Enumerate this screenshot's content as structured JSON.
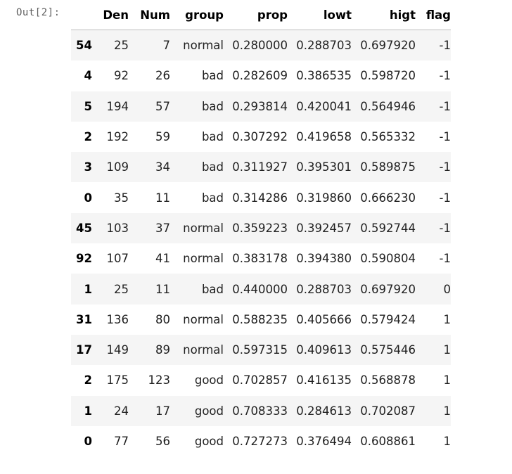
{
  "prompt": "Out[2]:",
  "columns": {
    "index": "",
    "den": "Den",
    "num": "Num",
    "group": "group",
    "prop": "prop",
    "lowt": "lowt",
    "higt": "higt",
    "flag": "flag"
  },
  "rows": [
    {
      "idx": "54",
      "den": "25",
      "num": "7",
      "group": "normal",
      "prop": "0.280000",
      "lowt": "0.288703",
      "higt": "0.697920",
      "flag": "-1"
    },
    {
      "idx": "4",
      "den": "92",
      "num": "26",
      "group": "bad",
      "prop": "0.282609",
      "lowt": "0.386535",
      "higt": "0.598720",
      "flag": "-1"
    },
    {
      "idx": "5",
      "den": "194",
      "num": "57",
      "group": "bad",
      "prop": "0.293814",
      "lowt": "0.420041",
      "higt": "0.564946",
      "flag": "-1"
    },
    {
      "idx": "2",
      "den": "192",
      "num": "59",
      "group": "bad",
      "prop": "0.307292",
      "lowt": "0.419658",
      "higt": "0.565332",
      "flag": "-1"
    },
    {
      "idx": "3",
      "den": "109",
      "num": "34",
      "group": "bad",
      "prop": "0.311927",
      "lowt": "0.395301",
      "higt": "0.589875",
      "flag": "-1"
    },
    {
      "idx": "0",
      "den": "35",
      "num": "11",
      "group": "bad",
      "prop": "0.314286",
      "lowt": "0.319860",
      "higt": "0.666230",
      "flag": "-1"
    },
    {
      "idx": "45",
      "den": "103",
      "num": "37",
      "group": "normal",
      "prop": "0.359223",
      "lowt": "0.392457",
      "higt": "0.592744",
      "flag": "-1"
    },
    {
      "idx": "92",
      "den": "107",
      "num": "41",
      "group": "normal",
      "prop": "0.383178",
      "lowt": "0.394380",
      "higt": "0.590804",
      "flag": "-1"
    },
    {
      "idx": "1",
      "den": "25",
      "num": "11",
      "group": "bad",
      "prop": "0.440000",
      "lowt": "0.288703",
      "higt": "0.697920",
      "flag": "0"
    },
    {
      "idx": "31",
      "den": "136",
      "num": "80",
      "group": "normal",
      "prop": "0.588235",
      "lowt": "0.405666",
      "higt": "0.579424",
      "flag": "1"
    },
    {
      "idx": "17",
      "den": "149",
      "num": "89",
      "group": "normal",
      "prop": "0.597315",
      "lowt": "0.409613",
      "higt": "0.575446",
      "flag": "1"
    },
    {
      "idx": "2",
      "den": "175",
      "num": "123",
      "group": "good",
      "prop": "0.702857",
      "lowt": "0.416135",
      "higt": "0.568878",
      "flag": "1"
    },
    {
      "idx": "1",
      "den": "24",
      "num": "17",
      "group": "good",
      "prop": "0.708333",
      "lowt": "0.284613",
      "higt": "0.702087",
      "flag": "1"
    },
    {
      "idx": "0",
      "den": "77",
      "num": "56",
      "group": "good",
      "prop": "0.727273",
      "lowt": "0.376494",
      "higt": "0.608861",
      "flag": "1"
    }
  ]
}
